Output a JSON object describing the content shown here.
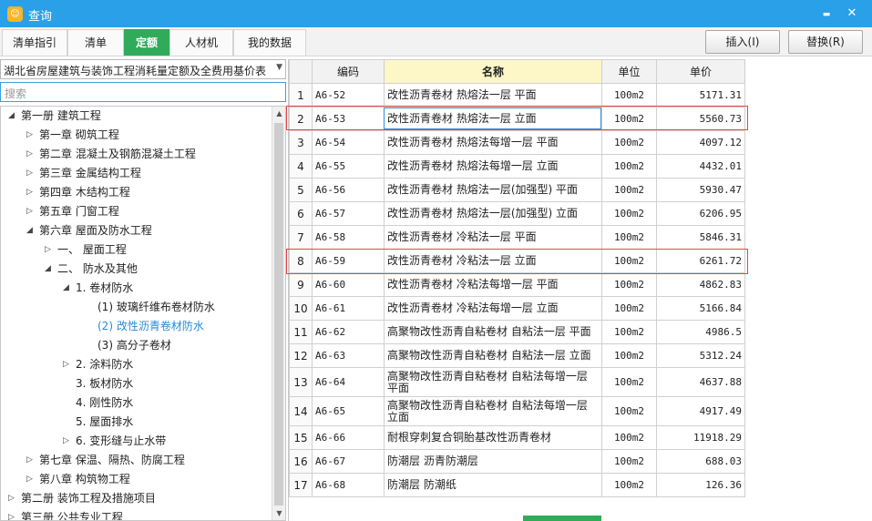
{
  "window": {
    "title": "查询",
    "minimize_glyph": "▬",
    "close_glyph": "✕",
    "app_icon": "app-logo-icon"
  },
  "tabs": [
    {
      "label": "清单指引",
      "active": false
    },
    {
      "label": "清单",
      "active": false
    },
    {
      "label": "定额",
      "active": true
    },
    {
      "label": "人材机",
      "active": false
    },
    {
      "label": "我的数据",
      "active": false
    }
  ],
  "actions": {
    "insert_label": "插入(I)",
    "replace_label": "替换(R)"
  },
  "library": {
    "selected": "湖北省房屋建筑与装饰工程消耗量定额及全费用基价表"
  },
  "search": {
    "placeholder": "搜索"
  },
  "tree": [
    {
      "label": "第一册 建筑工程",
      "exp": "◢"
    },
    {
      "label": "第一章 砌筑工程",
      "exp": "▷"
    },
    {
      "label": "第二章 混凝土及钢筋混凝土工程",
      "exp": "▷"
    },
    {
      "label": "第三章 金属结构工程",
      "exp": "▷"
    },
    {
      "label": "第四章 木结构工程",
      "exp": "▷"
    },
    {
      "label": "第五章 门窗工程",
      "exp": "▷"
    },
    {
      "label": "第六章 屋面及防水工程",
      "exp": "◢"
    },
    {
      "label": "一、 屋面工程",
      "exp": "▷"
    },
    {
      "label": "二、 防水及其他",
      "exp": "◢"
    },
    {
      "label": "1. 卷材防水",
      "exp": "◢"
    },
    {
      "label": "(1) 玻璃纤维布卷材防水",
      "exp": ""
    },
    {
      "label": "(2) 改性沥青卷材防水",
      "exp": "",
      "selected": true
    },
    {
      "label": "(3) 高分子卷材",
      "exp": ""
    },
    {
      "label": "2. 涂料防水",
      "exp": "▷"
    },
    {
      "label": "3. 板材防水",
      "exp": ""
    },
    {
      "label": "4. 刚性防水",
      "exp": ""
    },
    {
      "label": "5. 屋面排水",
      "exp": ""
    },
    {
      "label": "6. 变形缝与止水带",
      "exp": "▷"
    },
    {
      "label": "第七章 保温、隔热、防腐工程",
      "exp": "▷"
    },
    {
      "label": "第八章 构筑物工程",
      "exp": "▷"
    },
    {
      "label": "第二册 装饰工程及措施项目",
      "exp": "▷"
    },
    {
      "label": "第三册 公共专业工程",
      "exp": "▷"
    }
  ],
  "table": {
    "headers": {
      "code": "编码",
      "name": "名称",
      "unit": "单位",
      "price": "单价"
    },
    "rows": [
      {
        "n": "1",
        "code": "A6-52",
        "name": "改性沥青卷材 热熔法一层 平面",
        "unit": "100m2",
        "price": "5171.31"
      },
      {
        "n": "2",
        "code": "A6-53",
        "name": "改性沥青卷材 热熔法一层 立面",
        "unit": "100m2",
        "price": "5560.73"
      },
      {
        "n": "3",
        "code": "A6-54",
        "name": "改性沥青卷材 热熔法每增一层 平面",
        "unit": "100m2",
        "price": "4097.12"
      },
      {
        "n": "4",
        "code": "A6-55",
        "name": "改性沥青卷材 热熔法每增一层 立面",
        "unit": "100m2",
        "price": "4432.01"
      },
      {
        "n": "5",
        "code": "A6-56",
        "name": "改性沥青卷材 热熔法一层(加强型) 平面",
        "unit": "100m2",
        "price": "5930.47"
      },
      {
        "n": "6",
        "code": "A6-57",
        "name": "改性沥青卷材 热熔法一层(加强型) 立面",
        "unit": "100m2",
        "price": "6206.95"
      },
      {
        "n": "7",
        "code": "A6-58",
        "name": "改性沥青卷材 冷粘法一层 平面",
        "unit": "100m2",
        "price": "5846.31"
      },
      {
        "n": "8",
        "code": "A6-59",
        "name": "改性沥青卷材 冷粘法一层 立面",
        "unit": "100m2",
        "price": "6261.72"
      },
      {
        "n": "9",
        "code": "A6-60",
        "name": "改性沥青卷材 冷粘法每增一层 平面",
        "unit": "100m2",
        "price": "4862.83"
      },
      {
        "n": "10",
        "code": "A6-61",
        "name": "改性沥青卷材 冷粘法每增一层 立面",
        "unit": "100m2",
        "price": "5166.84"
      },
      {
        "n": "11",
        "code": "A6-62",
        "name": "高聚物改性沥青自粘卷材 自粘法一层 平面",
        "unit": "100m2",
        "price": "4986.5"
      },
      {
        "n": "12",
        "code": "A6-63",
        "name": "高聚物改性沥青自粘卷材 自粘法一层 立面",
        "unit": "100m2",
        "price": "5312.24"
      },
      {
        "n": "13",
        "code": "A6-64",
        "name": "高聚物改性沥青自粘卷材 自粘法每增一层 平面",
        "unit": "100m2",
        "price": "4637.88"
      },
      {
        "n": "14",
        "code": "A6-65",
        "name": "高聚物改性沥青自粘卷材 自粘法每增一层 立面",
        "unit": "100m2",
        "price": "4917.49"
      },
      {
        "n": "15",
        "code": "A6-66",
        "name": "耐根穿刺复合铜胎基改性沥青卷材",
        "unit": "100m2",
        "price": "11918.29"
      },
      {
        "n": "16",
        "code": "A6-67",
        "name": "防潮层 沥青防潮层",
        "unit": "100m2",
        "price": "688.03"
      },
      {
        "n": "17",
        "code": "A6-68",
        "name": "防潮层 防潮纸",
        "unit": "100m2",
        "price": "126.36"
      }
    ]
  },
  "colors": {
    "titlebar": "#29a0e8",
    "active_tab": "#2fab5a",
    "highlight_border": "#e04848",
    "selected_tree_text": "#2a8ad8"
  }
}
